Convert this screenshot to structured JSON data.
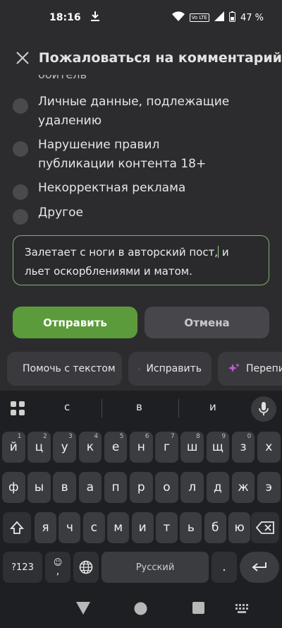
{
  "status": {
    "time": "18:16",
    "battery": "47 %",
    "volte": "Vo LTE"
  },
  "header": {
    "title": "Пожаловаться на комментарий"
  },
  "clipped_text": "обитель",
  "options": [
    {
      "label": "Личные данные, подлежащие удалению"
    },
    {
      "label": "Нарушение правил публикации контента 18+"
    },
    {
      "label": "Некорректная реклама"
    },
    {
      "label": "Другое"
    }
  ],
  "comment": {
    "before_caret": "Залетает с ноги в авторский пост,",
    "after_caret": " и льет оскорблениями и матом."
  },
  "buttons": {
    "submit": "Отправить",
    "cancel": "Отмена"
  },
  "ai_chips": [
    {
      "label": "Помочь с текстом",
      "icon": "sparkle-burst-icon"
    },
    {
      "label": "Исправить",
      "icon": "spellcheck-icon"
    },
    {
      "label": "Перепис",
      "icon": "sparkles-icon"
    }
  ],
  "keyboard": {
    "suggestions": [
      "с",
      "в",
      "и"
    ],
    "row1": [
      {
        "k": "й",
        "h": "1"
      },
      {
        "k": "ц",
        "h": "2"
      },
      {
        "k": "у",
        "h": "3"
      },
      {
        "k": "к",
        "h": "4"
      },
      {
        "k": "е",
        "h": "5"
      },
      {
        "k": "н",
        "h": "6"
      },
      {
        "k": "г",
        "h": "7"
      },
      {
        "k": "ш",
        "h": "8"
      },
      {
        "k": "щ",
        "h": "9"
      },
      {
        "k": "з",
        "h": "0"
      },
      {
        "k": "х",
        "h": ""
      }
    ],
    "row2": [
      "ф",
      "ы",
      "в",
      "а",
      "п",
      "р",
      "о",
      "л",
      "д",
      "ж",
      "э"
    ],
    "row3": [
      "я",
      "ч",
      "с",
      "м",
      "и",
      "т",
      "ь",
      "б",
      "ю"
    ],
    "symbols_label": "?123",
    "emoji_comma": ",",
    "space_label": "Русский",
    "period": "."
  },
  "colors": {
    "accent_green": "#5c9b3c",
    "focus_border": "#7fb36a",
    "background": "#2c2c2f"
  }
}
